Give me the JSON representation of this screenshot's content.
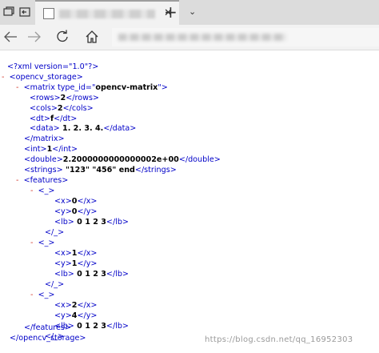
{
  "browser": {
    "tab_close": "✕",
    "new_tab": "+",
    "tab_menu": "⌄"
  },
  "xml": {
    "declaration": "<?xml version=\"1.0\"?>",
    "toggle": "-",
    "lines": {
      "opencv_open": "<opencv_storage>",
      "matrix_open_a": "<matrix type_id=\"",
      "matrix_type": "opencv-matrix",
      "matrix_open_b": "\">",
      "rows_open": "<rows>",
      "rows_val": "2",
      "rows_close": "</rows>",
      "cols_open": "<cols>",
      "cols_val": "2",
      "cols_close": "</cols>",
      "dt_open": "<dt>",
      "dt_val": "f",
      "dt_close": "</dt>",
      "data_open": "<data>",
      "data_val": " 1. 2. 3. 4.",
      "data_close": "</data>",
      "matrix_close": "</matrix>",
      "int_open": "<int>",
      "int_val": "1",
      "int_close": "</int>",
      "double_open": "<double>",
      "double_val": "2.2000000000000002e+00",
      "double_close": "</double>",
      "strings_open": "<strings>",
      "strings_val": " \"123\" \"456\" end",
      "strings_close": "</strings>",
      "features_open": "<features>",
      "item_open": "<_>",
      "item_close": "</_>",
      "x_open": "<x>",
      "x_close": "</x>",
      "y_open": "<y>",
      "y_close": "</y>",
      "lb_open": "<lb>",
      "lb_close": "</lb>",
      "features_close": "</features>",
      "opencv_close": "</opencv_storage>"
    },
    "features": [
      {
        "x": "0",
        "y": "0",
        "lb": " 0 1 2 3"
      },
      {
        "x": "1",
        "y": "1",
        "lb": " 0 1 2 3"
      },
      {
        "x": "2",
        "y": "4",
        "lb": " 0 1 2 3"
      }
    ]
  },
  "watermark": "https://blog.csdn.net/qq_16952303"
}
